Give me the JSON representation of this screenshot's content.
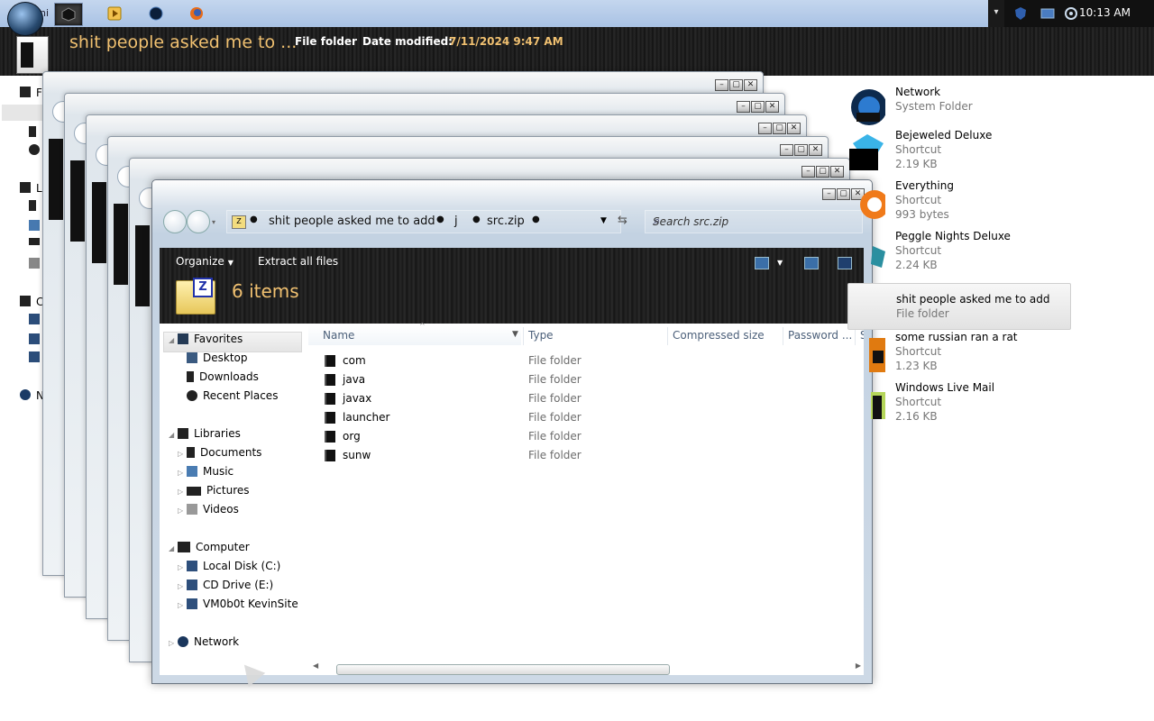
{
  "taskbar": {
    "start_label": "ni",
    "clock": "10:13 AM",
    "overflow_arrow": "▾",
    "buttons": [
      {
        "icon": "black-cube-icon",
        "active": true
      },
      {
        "icon": "media-player-icon",
        "active": false
      },
      {
        "icon": "blue-orb-icon",
        "active": false
      },
      {
        "icon": "firefox-icon",
        "active": false
      }
    ]
  },
  "info_bar": {
    "name": "shit people asked me to ...",
    "type": "File folder",
    "date_label": "Date modified:",
    "date_value": "7/11/2024 9:47 AM"
  },
  "window": {
    "breadcrumb": [
      "shit people asked me to add",
      "j",
      "src.zip"
    ],
    "search_placeholder": "Search src.zip",
    "toolbar": {
      "organize": "Organize",
      "extract_all": "Extract all files"
    },
    "item_count": "6 items",
    "columns": [
      "Name",
      "Type",
      "Compressed size",
      "Password ...",
      "Si"
    ],
    "files": [
      {
        "name": "com",
        "type": "File folder"
      },
      {
        "name": "java",
        "type": "File folder"
      },
      {
        "name": "javax",
        "type": "File folder"
      },
      {
        "name": "launcher",
        "type": "File folder"
      },
      {
        "name": "org",
        "type": "File folder"
      },
      {
        "name": "sunw",
        "type": "File folder"
      }
    ],
    "nav": {
      "favorites": "Favorites",
      "desktop": "Desktop",
      "downloads": "Downloads",
      "recent_places": "Recent Places",
      "libraries": "Libraries",
      "documents": "Documents",
      "music": "Music",
      "pictures": "Pictures",
      "videos": "Videos",
      "computer": "Computer",
      "local_disk": "Local Disk (C:)",
      "cd_drive": "CD Drive (E:)",
      "vm": "VM0b0t KevinSite",
      "network": "Network"
    }
  },
  "background_strip": {
    "labels": [
      "F",
      "L",
      "C",
      "N"
    ]
  },
  "desktop_items": [
    {
      "name": "Network",
      "line2": "System Folder",
      "line3": ""
    },
    {
      "name": "Bejeweled Deluxe",
      "line2": "Shortcut",
      "line3": "2.19 KB"
    },
    {
      "name": "Everything",
      "line2": "Shortcut",
      "line3": "993 bytes"
    },
    {
      "name": "Peggle Nights Deluxe",
      "line2": "Shortcut",
      "line3": "2.24 KB"
    },
    {
      "name": "shit people asked me to add",
      "line2": "File folder",
      "line3": ""
    },
    {
      "name": "some russian ran a rat",
      "line2": "Shortcut",
      "line3": "1.23 KB"
    },
    {
      "name": "Windows Live Mail",
      "line2": "Shortcut",
      "line3": "2.16 KB"
    }
  ]
}
